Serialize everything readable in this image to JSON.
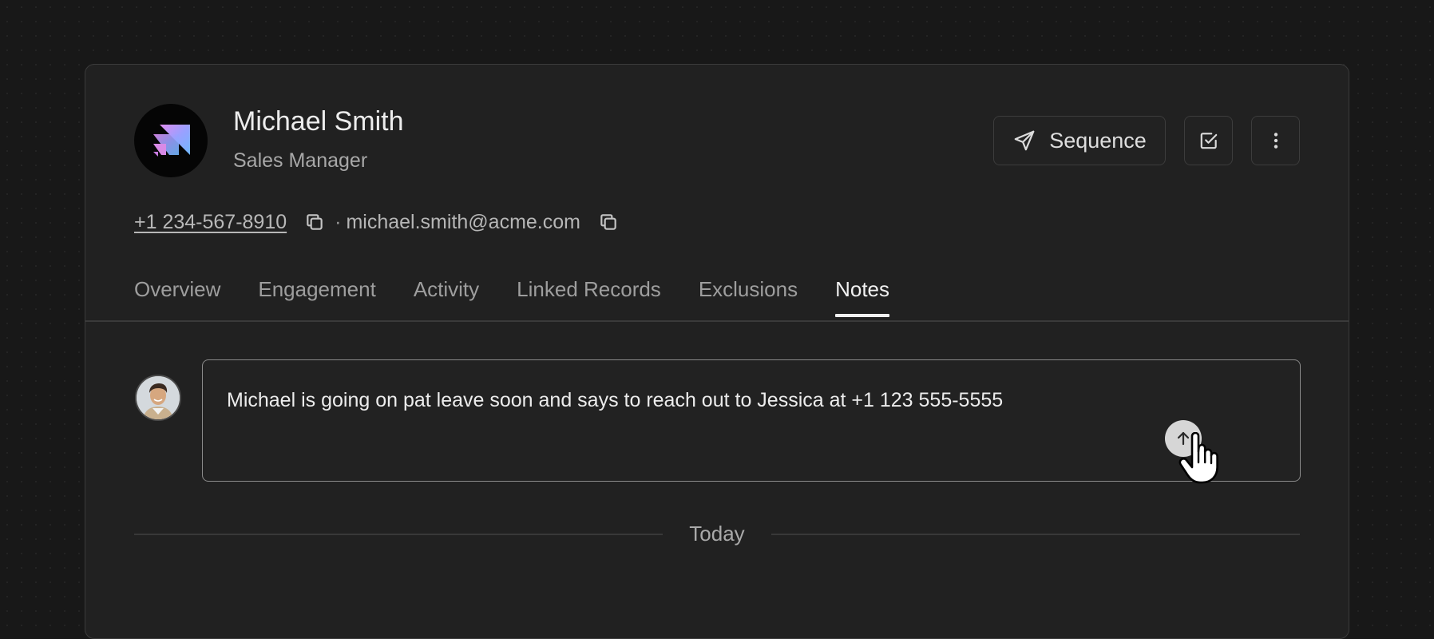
{
  "contact": {
    "name": "Michael Smith",
    "title": "Sales Manager",
    "phone": "+1 234-567-8910",
    "separator": "·",
    "email": "michael.smith@acme.com"
  },
  "actions": {
    "sequence_label": "Sequence",
    "sequence_icon": "send-icon",
    "task_icon": "checkbox-icon",
    "more_icon": "more-vertical-icon"
  },
  "tabs": [
    {
      "label": "Overview",
      "active": false
    },
    {
      "label": "Engagement",
      "active": false
    },
    {
      "label": "Activity",
      "active": false
    },
    {
      "label": "Linked Records",
      "active": false
    },
    {
      "label": "Exclusions",
      "active": false
    },
    {
      "label": "Notes",
      "active": true
    }
  ],
  "notes": {
    "input_value": "Michael is going on pat leave soon and says to reach out to Jessica at +1 123 555-5555",
    "send_icon": "arrow-up-icon",
    "date_separator": "Today"
  },
  "colors": {
    "background": "#181818",
    "card": "#212121",
    "accent_gradient": [
      "#5b8cff",
      "#c58bff"
    ]
  }
}
